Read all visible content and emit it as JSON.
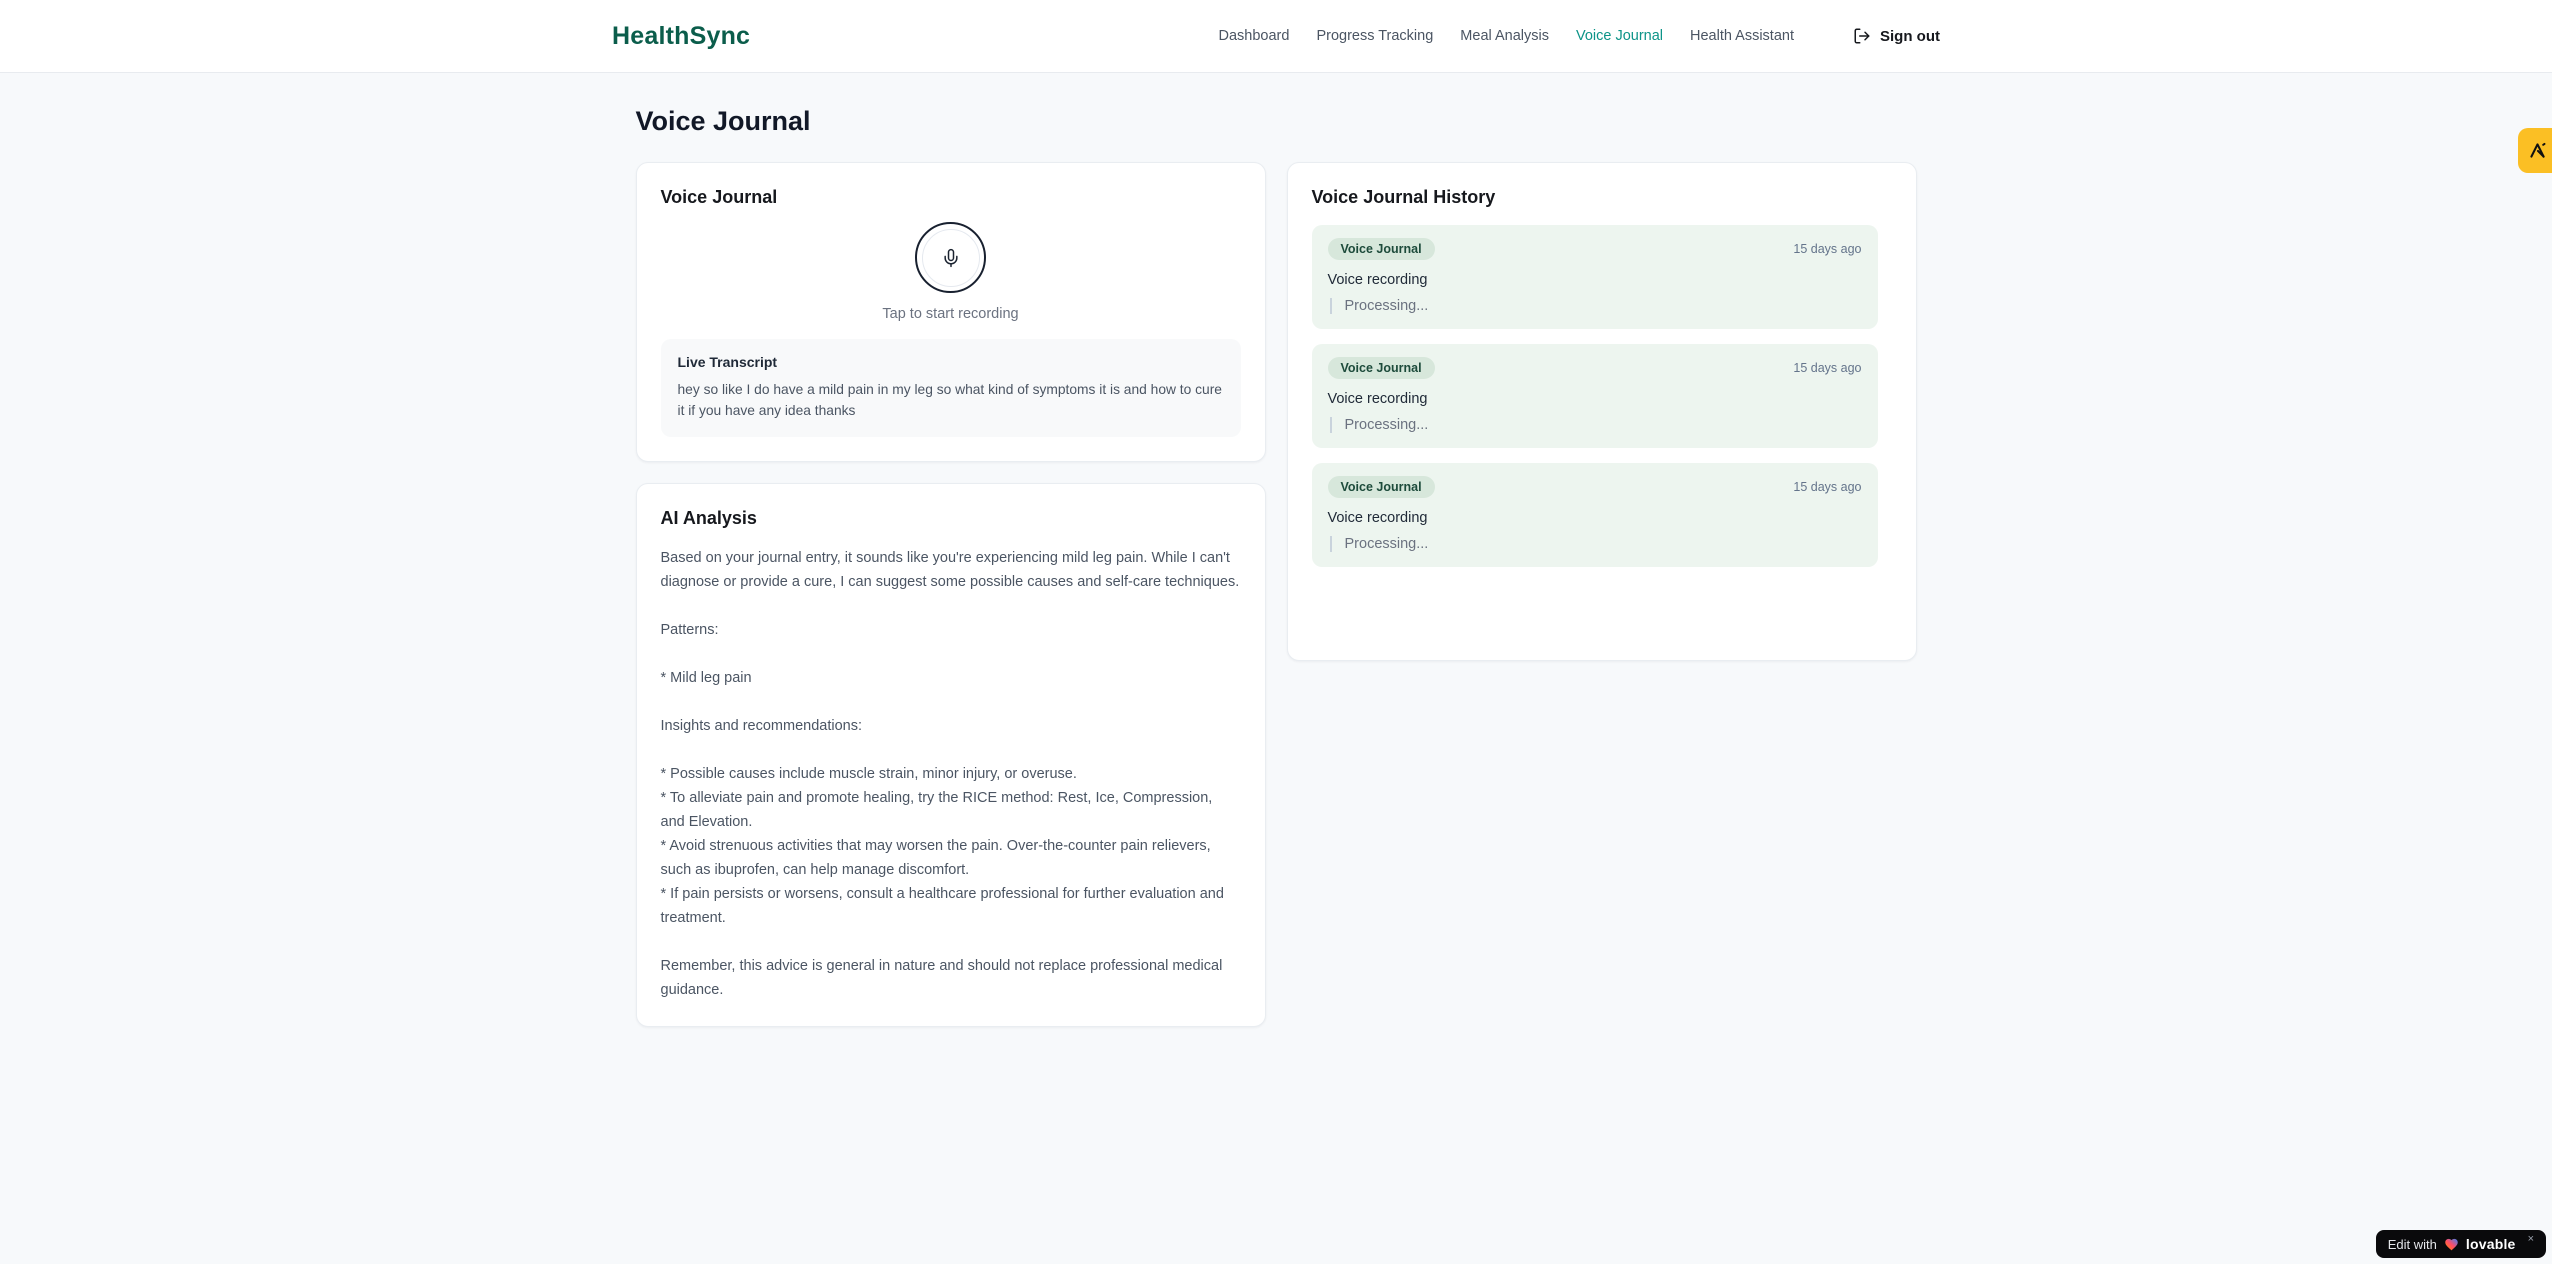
{
  "brand": {
    "name": "HealthSync"
  },
  "nav": {
    "items": [
      {
        "label": "Dashboard",
        "active": false
      },
      {
        "label": "Progress Tracking",
        "active": false
      },
      {
        "label": "Meal Analysis",
        "active": false
      },
      {
        "label": "Voice Journal",
        "active": true
      },
      {
        "label": "Health Assistant",
        "active": false
      }
    ],
    "sign_out_label": "Sign out"
  },
  "page": {
    "title": "Voice Journal"
  },
  "recorder": {
    "title": "Voice Journal",
    "tap_hint": "Tap to start recording",
    "transcript_title": "Live Transcript",
    "transcript_text": "hey so like I do have a mild pain in my leg so what kind of symptoms it is and how to cure it if you have any idea thanks"
  },
  "analysis": {
    "title": "AI Analysis",
    "body": "Based on your journal entry, it sounds like you're experiencing mild leg pain. While I can't diagnose or provide a cure, I can suggest some possible causes and self-care techniques.\n\nPatterns:\n\n* Mild leg pain\n\nInsights and recommendations:\n\n* Possible causes include muscle strain, minor injury, or overuse.\n* To alleviate pain and promote healing, try the RICE method: Rest, Ice, Compression, and Elevation.\n* Avoid strenuous activities that may worsen the pain. Over-the-counter pain relievers, such as ibuprofen, can help manage discomfort.\n* If pain persists or worsens, consult a healthcare professional for further evaluation and treatment.\n\nRemember, this advice is general in nature and should not replace professional medical guidance."
  },
  "history": {
    "title": "Voice Journal History",
    "entries": [
      {
        "badge": "Voice Journal",
        "time": "15 days ago",
        "title": "Voice recording",
        "status": "Processing..."
      },
      {
        "badge": "Voice Journal",
        "time": "15 days ago",
        "title": "Voice recording",
        "status": "Processing..."
      },
      {
        "badge": "Voice Journal",
        "time": "15 days ago",
        "title": "Voice recording",
        "status": "Processing..."
      }
    ]
  },
  "overlays": {
    "edit_badge": {
      "prefix": "Edit with",
      "brand": "lovable",
      "close": "×"
    }
  },
  "colors": {
    "logo_green": "#0b5d4b",
    "nav_active_teal": "#0d9488",
    "entry_bg_green": "#edf5ef",
    "badge_bg_green": "#d7e7db",
    "badge_text_green": "#1d4b3b",
    "side_badge_amber": "#fbbf24",
    "pill_bg": "#0a0a0c"
  }
}
